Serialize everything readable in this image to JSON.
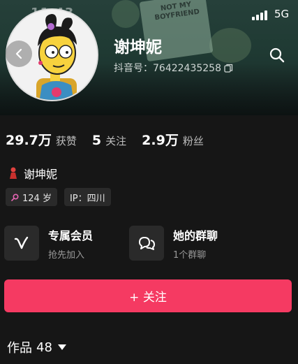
{
  "status_bar": {
    "time": "11:43",
    "network": "5G"
  },
  "banner": {
    "sign_text": "NOT MY BOYFRIEND"
  },
  "profile": {
    "name": "谢坤妮",
    "douyin_id": "抖音号：76422435258",
    "nickname": "谢坤妮",
    "age": "124 岁",
    "ip": "IP：四川"
  },
  "stats": [
    {
      "num": "29.7万",
      "label": "获赞"
    },
    {
      "num": "5",
      "label": "关注"
    },
    {
      "num": "2.9万",
      "label": "粉丝"
    }
  ],
  "cards": {
    "vip": {
      "title": "专属会员",
      "subtitle": "抢先加入",
      "icon": "vip-v-icon"
    },
    "group": {
      "title": "她的群聊",
      "subtitle": "1个群聊",
      "icon": "chat-bubbles-icon"
    }
  },
  "follow_button": {
    "label": "+ 关注",
    "color": "#f53a62"
  },
  "works_tab": {
    "label": "作品",
    "count": "48"
  },
  "colors": {
    "background": "#161616",
    "card_bg": "#2a2a2a",
    "accent": "#f53a62"
  }
}
